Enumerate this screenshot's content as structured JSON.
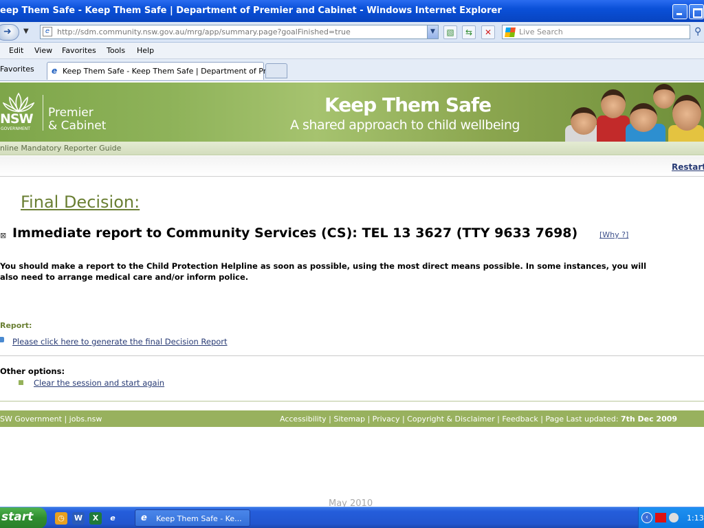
{
  "window": {
    "title": "eep Them Safe - Keep Them Safe | Department of Premier and Cabinet - Windows Internet Explorer"
  },
  "address_bar": {
    "url": "http://sdm.community.nsw.gov.au/mrg/app/summary.page?goalFinished=true",
    "search_placeholder": "Live Search"
  },
  "menu": {
    "items": [
      "Edit",
      "View",
      "Favorites",
      "Tools",
      "Help"
    ]
  },
  "tabs": {
    "favorites_label": "Favorites",
    "active_tab": "Keep Them Safe - Keep Them Safe | Department of Pr..."
  },
  "banner": {
    "logo_text": "NSW",
    "logo_sub": "GOVERNMENT",
    "org_line1": "Premier",
    "org_line2": "& Cabinet",
    "headline": "Keep Them Safe",
    "tagline": "A shared approach to child wellbeing"
  },
  "subbanner": {
    "guide_title": "nline Mandatory Reporter Guide",
    "restart": "Restart"
  },
  "content": {
    "heading": "Final Decision:",
    "decision_icon": "⊠",
    "decision": "Immediate report to Community Services (CS): TEL 13 3627 (TTY 9633 7698)",
    "why_link": "[Why ?]",
    "para_line1": "You should make a report to the Child Protection Helpline as soon as possible, using the most direct means possible. In some instances, you will",
    "para_line2": "also need to arrange medical care and/or inform police.",
    "report_label": "Report:",
    "report_link": "Please click here to generate the final Decision Report",
    "other_label": "Other options:",
    "clear_link": "Clear the session and start again"
  },
  "footer": {
    "left": "SW Government | jobs.nsw",
    "links": "Accessibility | Sitemap | Privacy | Copyright & Disclaimer | Feedback | Page Last updated:",
    "updated": "7th Dec 2009"
  },
  "watermark": "May 2010",
  "taskbar": {
    "start": "start",
    "task_label": "Keep Them Safe - Ke...",
    "clock": "1:13"
  }
}
